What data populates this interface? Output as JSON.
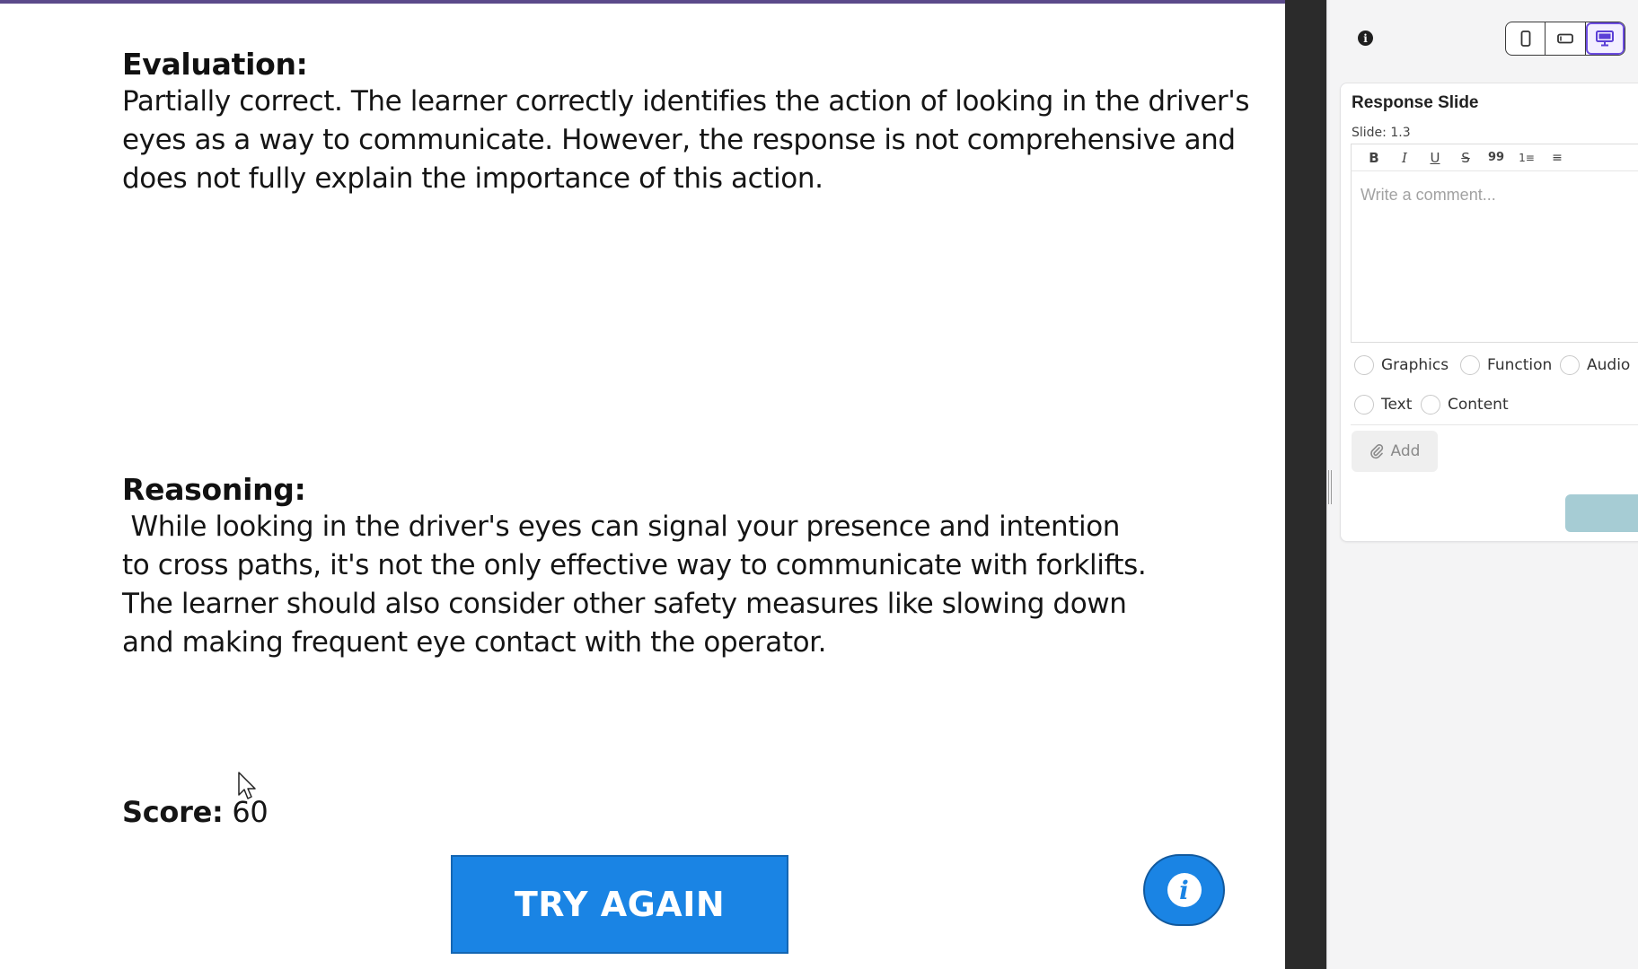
{
  "slide": {
    "evaluation": {
      "heading": "Evaluation:",
      "text": "Partially correct. The learner correctly identifies the action of looking in the driver's\neyes as a way to communicate. However, the response is not comprehensive and\ndoes not fully explain the importance of this action."
    },
    "reasoning": {
      "heading": "Reasoning:",
      "text": " While looking in the driver's eyes can signal your presence and intention\nto cross paths, it's not the only effective way to communicate with forklifts.\nThe learner should also consider other safety measures like slowing down\nand making frequent eye contact with the operator."
    },
    "score": {
      "label": "Score:",
      "value": "60"
    },
    "try_again_label": "TRY AGAIN",
    "info_button_icon": "info-icon"
  },
  "panel": {
    "device_modes": [
      "mobile-portrait",
      "mobile-landscape",
      "desktop"
    ],
    "active_device": "desktop",
    "card": {
      "title": "Response Slide",
      "slide_label": "Slide: 1.3",
      "toolbar": [
        "B",
        "I",
        "U",
        "S",
        "99",
        "1≡",
        "≡"
      ],
      "comment_placeholder": "Write a comment...",
      "categories": [
        "Graphics",
        "Function",
        "Audio",
        "Text",
        "Content"
      ],
      "add_label": "Add"
    }
  },
  "colors": {
    "accent_blue": "#1a84e4",
    "active_device_outline": "#6c4ce0",
    "divider": "#2b2b2b"
  }
}
